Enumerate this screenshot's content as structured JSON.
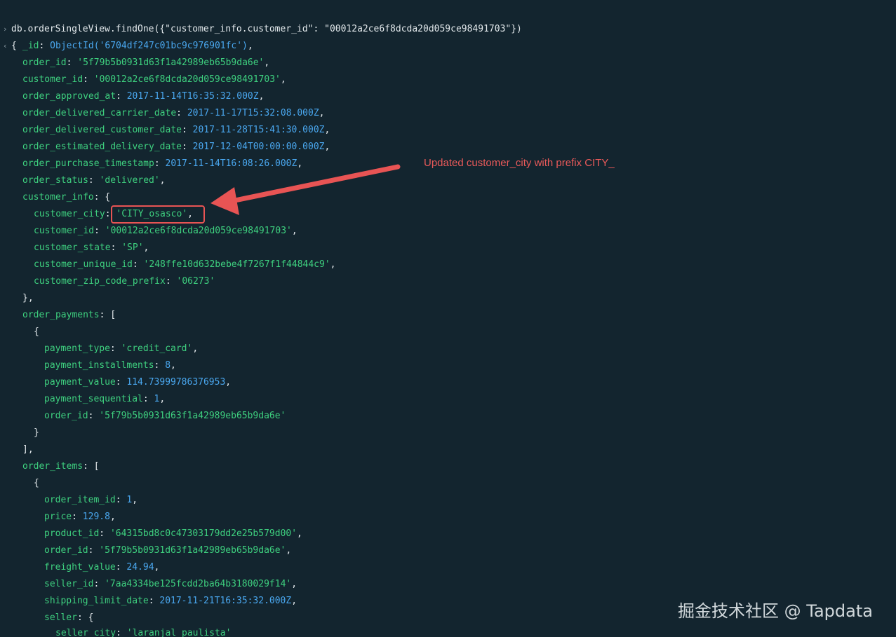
{
  "command": "db.orderSingleView.findOne({\"customer_info.customer_id\": \"00012a2ce6f8dcda20d059ce98491703\"})",
  "result_open": "{",
  "fields": {
    "_id": {
      "key": "_id",
      "value": "ObjectId('6704df247c01bc9c976901fc')"
    },
    "order_id": {
      "key": "order_id",
      "value": "'5f79b5b0931d63f1a42989eb65b9da6e'"
    },
    "customer_id": {
      "key": "customer_id",
      "value": "'00012a2ce6f8dcda20d059ce98491703'"
    },
    "order_approved_at": {
      "key": "order_approved_at",
      "value": "2017-11-14T16:35:32.000Z"
    },
    "order_delivered_carrier_date": {
      "key": "order_delivered_carrier_date",
      "value": "2017-11-17T15:32:08.000Z"
    },
    "order_delivered_customer_date": {
      "key": "order_delivered_customer_date",
      "value": "2017-11-28T15:41:30.000Z"
    },
    "order_estimated_delivery_date": {
      "key": "order_estimated_delivery_date",
      "value": "2017-12-04T00:00:00.000Z"
    },
    "order_purchase_timestamp": {
      "key": "order_purchase_timestamp",
      "value": "2017-11-14T16:08:26.000Z"
    },
    "order_status": {
      "key": "order_status",
      "value": "'delivered'"
    },
    "customer_info_key": "customer_info",
    "customer_info": {
      "customer_city": {
        "key": "customer_city",
        "value": "'CITY_osasco'"
      },
      "customer_id": {
        "key": "customer_id",
        "value": "'00012a2ce6f8dcda20d059ce98491703'"
      },
      "customer_state": {
        "key": "customer_state",
        "value": "'SP'"
      },
      "customer_unique_id": {
        "key": "customer_unique_id",
        "value": "'248ffe10d632bebe4f7267f1f44844c9'"
      },
      "customer_zip_code_prefix": {
        "key": "customer_zip_code_prefix",
        "value": "'06273'"
      }
    },
    "order_payments_key": "order_payments",
    "order_payments": {
      "payment_type": {
        "key": "payment_type",
        "value": "'credit_card'"
      },
      "payment_installments": {
        "key": "payment_installments",
        "value": "8"
      },
      "payment_value": {
        "key": "payment_value",
        "value": "114.73999786376953"
      },
      "payment_sequential": {
        "key": "payment_sequential",
        "value": "1"
      },
      "order_id": {
        "key": "order_id",
        "value": "'5f79b5b0931d63f1a42989eb65b9da6e'"
      }
    },
    "order_items_key": "order_items",
    "order_items": {
      "order_item_id": {
        "key": "order_item_id",
        "value": "1"
      },
      "price": {
        "key": "price",
        "value": "129.8"
      },
      "product_id": {
        "key": "product_id",
        "value": "'64315bd8c0c47303179dd2e25b579d00'"
      },
      "order_id": {
        "key": "order_id",
        "value": "'5f79b5b0931d63f1a42989eb65b9da6e'"
      },
      "freight_value": {
        "key": "freight_value",
        "value": "24.94"
      },
      "seller_id": {
        "key": "seller_id",
        "value": "'7aa4334be125fcdd2ba64b3180029f14'"
      },
      "shipping_limit_date": {
        "key": "shipping_limit_date",
        "value": "2017-11-21T16:35:32.000Z"
      },
      "seller_key": "seller",
      "seller_city": {
        "key": "seller_city",
        "value": "'laranjal paulista'"
      }
    }
  },
  "annotation": "Updated customer_city with prefix CITY_",
  "watermark": "掘金技术社区 @ Tapdata",
  "colors": {
    "background": "#13252f",
    "key": "#3ed07f",
    "string": "#3ed07f",
    "number": "#4aa8f0",
    "annotation": "#ea5a5a"
  },
  "icons": {
    "prompt": "chevron-right-icon",
    "result": "chevron-left-icon"
  }
}
